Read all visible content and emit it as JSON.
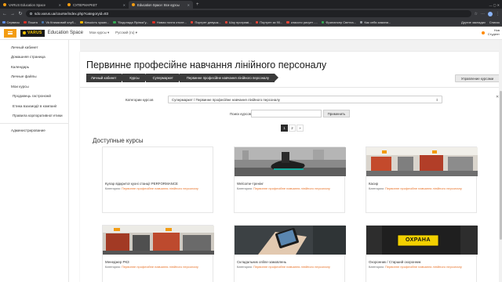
{
  "browser": {
    "tabs": [
      {
        "label": "VARUS Education Space",
        "color": "#f39c12",
        "active": false
      },
      {
        "label": "СУПЕРМАРКЕТ",
        "color": "#f39c12",
        "active": false
      },
      {
        "label": "Education Space: Все курсы",
        "color": "#f39c12",
        "active": true
      }
    ],
    "new_tab": "+",
    "url": "sdo.varus.ua/course/index.php?categoryid=83",
    "bookmarks": [
      {
        "label": "Сервисы",
        "color": "#5f8ee8"
      },
      {
        "label": "Пошта",
        "color": "#d93025"
      },
      {
        "label": "Vk Книжковий клуб...",
        "color": "#4a76a8"
      },
      {
        "label": "Кількість чужих...",
        "color": "#f4b400"
      },
      {
        "label": "\"Водолада Ярінка\"у...",
        "color": "#34a853"
      },
      {
        "label": "Новая почта отсле...",
        "color": "#d93025"
      },
      {
        "label": "Портрет девушк...",
        "color": "#ea4335"
      },
      {
        "label": "Шоу програмі...",
        "color": "#ea4335"
      },
      {
        "label": "Портрет за 90...",
        "color": "#ea4335"
      },
      {
        "label": "классно рисует -...",
        "color": "#ea4335"
      },
      {
        "label": "Фрилансер Светла...",
        "color": "#34a853"
      },
      {
        "label": "Как себя замани...",
        "color": "#9aa0a6"
      }
    ],
    "bookmarks_right": [
      "Другие закладки",
      "Список"
    ]
  },
  "header": {
    "site_name": "Education Space",
    "logo_text": "VARUS",
    "links": [
      "Мои курсы ▾",
      "Русский (ru) ▾"
    ],
    "user_line1": "Нов",
    "user_line2": "Студент"
  },
  "sidebar": {
    "items": [
      {
        "label": "Личный кабинет",
        "sub": false
      },
      {
        "label": "Домашняя страница",
        "sub": false
      },
      {
        "label": "Календарь",
        "sub": false
      },
      {
        "label": "Личные файлы",
        "sub": false
      },
      {
        "label": "Мои курсы",
        "sub": false
      },
      {
        "label": "Продавець гастрономії",
        "sub": true
      },
      {
        "label": "Етика взаємодії в компанії",
        "sub": true
      },
      {
        "label": "Правила корпоративної етики",
        "sub": true
      }
    ],
    "admin": "Администрирование"
  },
  "page": {
    "title": "Первинне професійне навчання лінійного персоналу",
    "breadcrumbs": [
      "Личный кабинет",
      "Курсы",
      "Супермаркет",
      "Первинне професійне навчання лінійного персоналу"
    ],
    "manage_button": "Управление курсами",
    "category_label": "Категории курсов",
    "category_value": "Супермаркет / Первинне професійне навчання лінійного персоналу",
    "search_label": "Поиск курсов",
    "search_value": "",
    "apply_button": "Применить",
    "pages": [
      "1",
      "2",
      "»"
    ],
    "section_title": "Доступные курсы",
    "category_key": "Категория:"
  },
  "courses": [
    {
      "name": "Кулар відкритої кухні станції PERFORMANCE",
      "category": "Первинне професійне навчання лінійного персоналу",
      "image": "none"
    },
    {
      "name": "Welcome-тренінг",
      "category": "Первинне професійне навчання лінійного персоналу",
      "image": "shoe"
    },
    {
      "name": "Касир",
      "category": "Первинне професійне навчання лінійного персоналу",
      "image": "checkout"
    },
    {
      "name": "Менеджер РКЗ",
      "category": "Первинне професійне навчання лінійного персоналу",
      "image": "store"
    },
    {
      "name": "Складальник online-замовлень",
      "category": "Первинне професійне навчання лінійного персоналу",
      "image": "phone"
    },
    {
      "name": "Охоронник / Старший охоронник",
      "category": "Первинне професійне навчання лінійного персоналу",
      "image": "security"
    }
  ],
  "security_patch_text": "ОХРАНА"
}
